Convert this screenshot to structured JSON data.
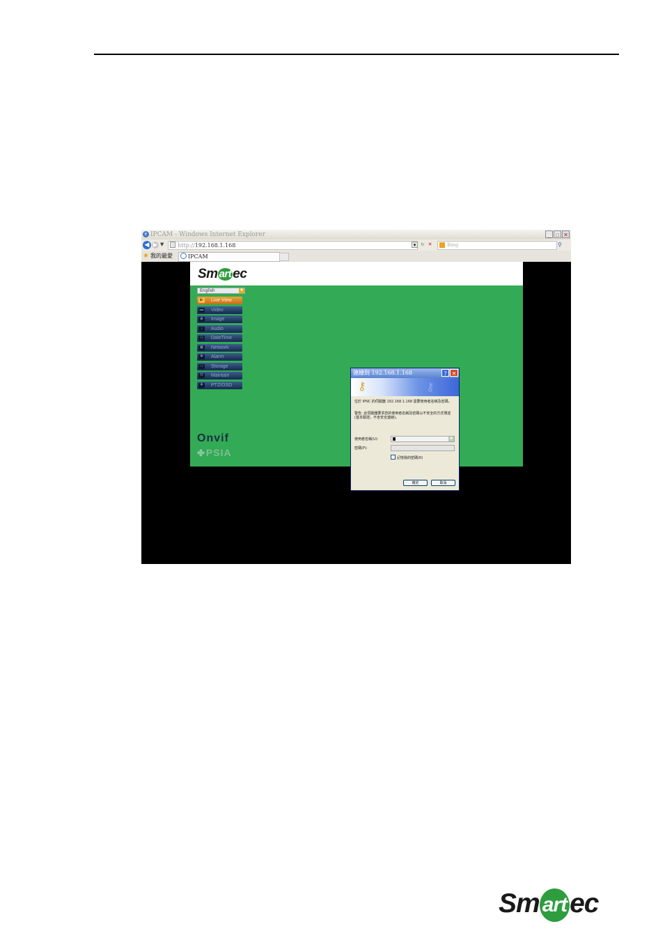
{
  "browser": {
    "title": "IPCAM - Windows Internet Explorer",
    "address_protocol": "http://",
    "address_host": "192.168.1.168",
    "search_placeholder": "Bing",
    "favorites_label": "我的最愛",
    "tab_label": "IPCAM"
  },
  "app": {
    "logo_left": "Sm",
    "logo_mid": "art",
    "logo_right": "ec",
    "language": "English",
    "menu": [
      {
        "label": "Live View",
        "active": true
      },
      {
        "label": "Video"
      },
      {
        "label": "Image"
      },
      {
        "label": "Audio"
      },
      {
        "label": "DateTime"
      },
      {
        "label": "Network"
      },
      {
        "label": "Alarm"
      },
      {
        "label": "Storage"
      },
      {
        "label": "Maintain"
      },
      {
        "label": "PTZ/OSD"
      }
    ],
    "onvif": "Onvif",
    "psia": "PSIA"
  },
  "dialog": {
    "title": "連線到 192.168.1.168",
    "message": "位於 IPNC 的伺服器 192.168.1.168 需要使用者名稱及密碼。",
    "warning": "警告: 此伺服器要求您的使用者名稱及密碼以不安全的方式傳送 (基本驗證，不含安全連線)。",
    "username_label": "使用者名稱(U):",
    "password_label": "密碼(P):",
    "remember_label": "記憶我的密碼(R)",
    "ok_label": "確定",
    "cancel_label": "取消"
  },
  "footer": {
    "logo_left": "Sm",
    "logo_mid": "art",
    "logo_right": "ec"
  }
}
